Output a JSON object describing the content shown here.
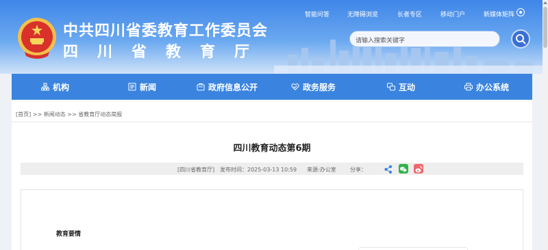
{
  "header": {
    "title": "中共四川省委教育工作委员会",
    "subtitle": "四川省教育厅",
    "top_links": [
      "智能问答",
      "无障碍浏览",
      "长者专区",
      "移动门户",
      "新媒体矩阵"
    ],
    "search_placeholder": "请输入搜索关键字"
  },
  "nav": {
    "items": [
      {
        "label": "机构",
        "icon": "institution-icon"
      },
      {
        "label": "新闻",
        "icon": "news-icon"
      },
      {
        "label": "政府信息公开",
        "icon": "info-disclosure-icon"
      },
      {
        "label": "政务服务",
        "icon": "service-heart-icon"
      },
      {
        "label": "互动",
        "icon": "interaction-icon"
      },
      {
        "label": "办公系统",
        "icon": "printer-icon"
      }
    ]
  },
  "breadcrumb": {
    "home": "[首页]",
    "sep1": ">>",
    "level1": "新闻动态",
    "sep2": ">>",
    "level2": "省教育厅动态简报"
  },
  "article": {
    "title": "四川教育动态第6期",
    "source": "[四川省教育厅]",
    "publish_time": "发布时间：2025-03-13 10:59",
    "origin": "来源:办公室",
    "share_label": "分享：",
    "section_heading": "教育要情"
  },
  "colors": {
    "nav_bg": "#3a84e0",
    "share_generic": "#2d7fe6",
    "share_wechat": "#32b34a",
    "share_weibo": "#f0676b"
  }
}
